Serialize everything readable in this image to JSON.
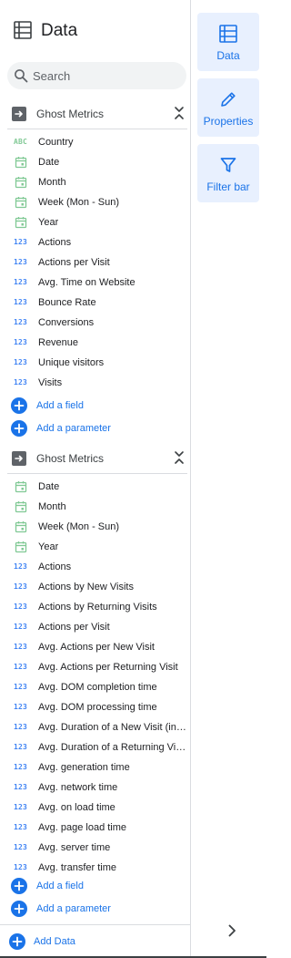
{
  "panel": {
    "title": "Data",
    "icon": "data-table-icon"
  },
  "search": {
    "placeholder": "Search"
  },
  "sources": [
    {
      "name": "Ghost Metrics",
      "fields": [
        {
          "type": "text",
          "icon": "ABC",
          "label": "Country"
        },
        {
          "type": "date",
          "icon": "calendar-icon",
          "label": "Date"
        },
        {
          "type": "date",
          "icon": "calendar-icon",
          "label": "Month"
        },
        {
          "type": "date",
          "icon": "calendar-icon",
          "label": "Week (Mon - Sun)"
        },
        {
          "type": "date",
          "icon": "calendar-icon",
          "label": "Year"
        },
        {
          "type": "number",
          "icon": "123",
          "label": "Actions"
        },
        {
          "type": "number",
          "icon": "123",
          "label": "Actions per Visit"
        },
        {
          "type": "number",
          "icon": "123",
          "label": "Avg. Time on Website"
        },
        {
          "type": "number",
          "icon": "123",
          "label": "Bounce Rate"
        },
        {
          "type": "number",
          "icon": "123",
          "label": "Conversions"
        },
        {
          "type": "number",
          "icon": "123",
          "label": "Revenue"
        },
        {
          "type": "number",
          "icon": "123",
          "label": "Unique visitors"
        },
        {
          "type": "number",
          "icon": "123",
          "label": "Visits"
        }
      ],
      "add_field": "Add a field",
      "add_parameter": "Add a parameter"
    },
    {
      "name": "Ghost Metrics",
      "fields": [
        {
          "type": "date",
          "icon": "calendar-icon",
          "label": "Date"
        },
        {
          "type": "date",
          "icon": "calendar-icon",
          "label": "Month"
        },
        {
          "type": "date",
          "icon": "calendar-icon",
          "label": "Week (Mon - Sun)"
        },
        {
          "type": "date",
          "icon": "calendar-icon",
          "label": "Year"
        },
        {
          "type": "number",
          "icon": "123",
          "label": "Actions"
        },
        {
          "type": "number",
          "icon": "123",
          "label": "Actions by New Visits"
        },
        {
          "type": "number",
          "icon": "123",
          "label": "Actions by Returning Visits"
        },
        {
          "type": "number",
          "icon": "123",
          "label": "Actions per Visit"
        },
        {
          "type": "number",
          "icon": "123",
          "label": "Avg. Actions per New Visit"
        },
        {
          "type": "number",
          "icon": "123",
          "label": "Avg. Actions per Returning Visit"
        },
        {
          "type": "number",
          "icon": "123",
          "label": "Avg. DOM completion time"
        },
        {
          "type": "number",
          "icon": "123",
          "label": "Avg. DOM processing time"
        },
        {
          "type": "number",
          "icon": "123",
          "label": "Avg. Duration of a New Visit (in ..."
        },
        {
          "type": "number",
          "icon": "123",
          "label": "Avg. Duration of a Returning Vis..."
        },
        {
          "type": "number",
          "icon": "123",
          "label": "Avg. generation time"
        },
        {
          "type": "number",
          "icon": "123",
          "label": "Avg. network time"
        },
        {
          "type": "number",
          "icon": "123",
          "label": "Avg. on load time"
        },
        {
          "type": "number",
          "icon": "123",
          "label": "Avg. page load time"
        },
        {
          "type": "number",
          "icon": "123",
          "label": "Avg. server time"
        },
        {
          "type": "number",
          "icon": "123",
          "label": "Avg. transfer time"
        }
      ],
      "add_field": "Add a field",
      "add_parameter": "Add a parameter"
    }
  ],
  "footer": {
    "add_data": "Add Data"
  },
  "rail": {
    "tabs": [
      {
        "label": "Data",
        "icon": "data-table-icon"
      },
      {
        "label": "Properties",
        "icon": "pencil-icon"
      },
      {
        "label": "Filter bar",
        "icon": "filter-icon"
      }
    ]
  },
  "colors": {
    "accent": "#1a73e8",
    "tab_bg": "#e8f0fe",
    "number_type": "#4285f4",
    "date_type": "#81c995",
    "text_type": "#81c995"
  }
}
